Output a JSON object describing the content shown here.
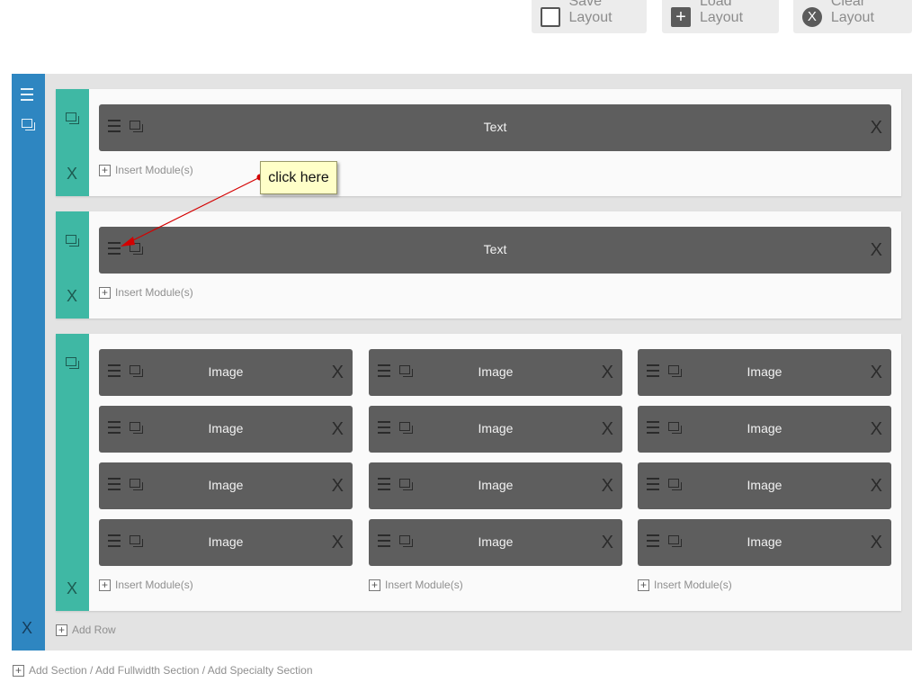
{
  "toolbar": {
    "save_label": "Save Layout",
    "load_label": "Load Layout",
    "clear_label": "Clear Layout",
    "clear_icon_glyph": "X"
  },
  "rows": [
    {
      "modules": [
        {
          "label": "Text"
        }
      ],
      "insert_label": "Insert Module(s)"
    },
    {
      "modules": [
        {
          "label": "Text"
        }
      ],
      "insert_label": "Insert Module(s)"
    },
    {
      "columns": [
        {
          "modules": [
            {
              "label": "Image"
            },
            {
              "label": "Image"
            },
            {
              "label": "Image"
            },
            {
              "label": "Image"
            }
          ],
          "insert_label": "Insert Module(s)"
        },
        {
          "modules": [
            {
              "label": "Image"
            },
            {
              "label": "Image"
            },
            {
              "label": "Image"
            },
            {
              "label": "Image"
            }
          ],
          "insert_label": "Insert Module(s)"
        },
        {
          "modules": [
            {
              "label": "Image"
            },
            {
              "label": "Image"
            },
            {
              "label": "Image"
            },
            {
              "label": "Image"
            }
          ],
          "insert_label": "Insert Module(s)"
        }
      ]
    }
  ],
  "close_glyph": "X",
  "add_row_label": "Add Row",
  "add_section_label": "Add Section / Add Fullwidth Section / Add Specialty Section",
  "annotation": {
    "text": "click here"
  },
  "colors": {
    "section_bar": "#2e86c1",
    "row_bar": "#3fb8a4",
    "module_bg": "#5e5e5e",
    "callout_bg": "#ffffc8",
    "arrow": "#d40000"
  }
}
